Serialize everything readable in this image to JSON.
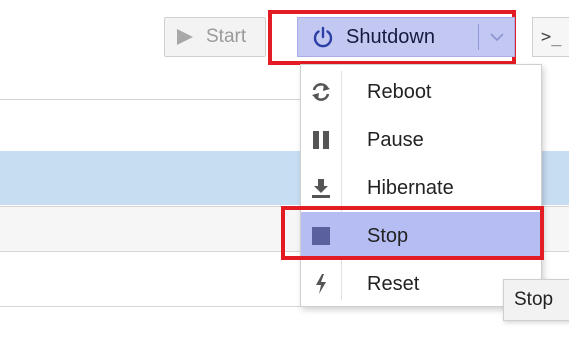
{
  "toolbar": {
    "start_label": "Start",
    "shutdown_label": "Shutdown",
    "console_label": ">_"
  },
  "menu": {
    "items": [
      {
        "label": "Reboot",
        "icon": "refresh-icon"
      },
      {
        "label": "Pause",
        "icon": "pause-icon"
      },
      {
        "label": "Hibernate",
        "icon": "download-icon"
      },
      {
        "label": "Stop",
        "icon": "stop-icon"
      },
      {
        "label": "Reset",
        "icon": "bolt-icon"
      }
    ]
  },
  "tooltip": {
    "text": "Stop"
  },
  "colors": {
    "highlight": "#e31b23",
    "active_button": "#c3c8f3",
    "selected_row": "#c7ddf2"
  }
}
